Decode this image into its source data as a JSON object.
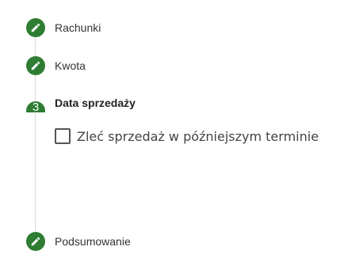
{
  "steps": [
    {
      "label": "Rachunki",
      "state": "completed",
      "icon": "pencil-icon"
    },
    {
      "label": "Kwota",
      "state": "completed",
      "icon": "pencil-icon"
    },
    {
      "label": "Data sprzedaży",
      "state": "active",
      "number": "3"
    },
    {
      "label": "Podsumowanie",
      "state": "completed",
      "icon": "pencil-icon"
    }
  ],
  "active_content": {
    "checkbox_label": "Zleć sprzedaż w późniejszym terminie",
    "checked": false
  },
  "colors": {
    "completed": "#2e7d32",
    "line": "#dcdcdc"
  }
}
